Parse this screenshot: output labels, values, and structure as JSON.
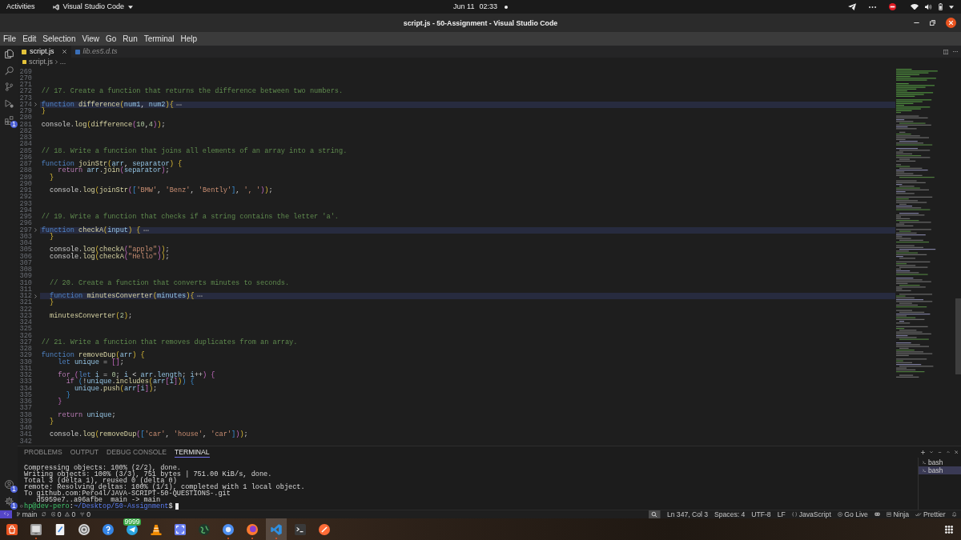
{
  "top_bar": {
    "activities": "Activities",
    "app_menu": "Visual Studio Code",
    "date": "Jun 11",
    "time": "02:33"
  },
  "window": {
    "title": "script.js - 50-Assignment - Visual Studio Code"
  },
  "menu": [
    "File",
    "Edit",
    "Selection",
    "View",
    "Go",
    "Run",
    "Terminal",
    "Help"
  ],
  "activity_bar": {
    "top": [
      {
        "kind": "explorer"
      },
      {
        "kind": "search"
      },
      {
        "kind": "scm"
      },
      {
        "kind": "run"
      },
      {
        "kind": "extensions",
        "badge": "1"
      }
    ],
    "bottom": [
      {
        "kind": "accounts",
        "badge": "1"
      },
      {
        "kind": "manage",
        "badge": "1"
      }
    ]
  },
  "tabs": [
    {
      "label": "script.js",
      "kind": "javascript",
      "selected": true,
      "preview": false
    },
    {
      "label": "lib.es5.d.ts",
      "kind": "typescript",
      "selected": false,
      "preview": true
    }
  ],
  "breadcrumb": [
    "script.js",
    "..."
  ],
  "editor": {
    "lines": [
      {
        "number": "269",
        "folded": false
      },
      {
        "number": "270",
        "folded": false
      },
      {
        "number": "271",
        "folded": false
      },
      {
        "number": "272",
        "folded": false,
        "tokens": [
          {
            "kind": "comment",
            "text": "// 17. Create a function that returns the difference between two numbers."
          }
        ]
      },
      {
        "number": "273",
        "folded": false
      },
      {
        "number": "274",
        "folded": true,
        "tokens": [
          {
            "kind": "keyword",
            "text": "function "
          },
          {
            "kind": "function",
            "text": "difference"
          },
          {
            "kind": "bracket1",
            "text": "("
          },
          {
            "kind": "variable",
            "text": "num1"
          },
          {
            "kind": "plain",
            "text": ", "
          },
          {
            "kind": "variable",
            "text": "num2"
          },
          {
            "kind": "bracket1",
            "text": "){"
          }
        ]
      },
      {
        "number": "279",
        "folded": false,
        "tokens": [
          {
            "kind": "bracket1",
            "text": "}"
          }
        ]
      },
      {
        "number": "280",
        "folded": false
      },
      {
        "number": "281",
        "folded": false,
        "tokens": [
          {
            "kind": "plain",
            "text": "console."
          },
          {
            "kind": "function",
            "text": "log"
          },
          {
            "kind": "bracket1",
            "text": "("
          },
          {
            "kind": "function",
            "text": "difference"
          },
          {
            "kind": "bracket2",
            "text": "("
          },
          {
            "kind": "number",
            "text": "10"
          },
          {
            "kind": "plain",
            "text": ","
          },
          {
            "kind": "number",
            "text": "4"
          },
          {
            "kind": "bracket2",
            "text": ")"
          },
          {
            "kind": "bracket1",
            "text": ")"
          },
          {
            "kind": "plain",
            "text": ";"
          }
        ]
      },
      {
        "number": "282",
        "folded": false
      },
      {
        "number": "283",
        "folded": false
      },
      {
        "number": "284",
        "folded": false
      },
      {
        "number": "285",
        "folded": false,
        "tokens": [
          {
            "kind": "comment",
            "text": "// 18. Write a function that joins all elements of an array into a string."
          }
        ]
      },
      {
        "number": "286",
        "folded": false
      },
      {
        "number": "287",
        "folded": false,
        "tokens": [
          {
            "kind": "keyword",
            "text": "function "
          },
          {
            "kind": "function",
            "text": "joinStr"
          },
          {
            "kind": "bracket1",
            "text": "("
          },
          {
            "kind": "variable",
            "text": "arr"
          },
          {
            "kind": "plain",
            "text": ", "
          },
          {
            "kind": "variable",
            "text": "separator"
          },
          {
            "kind": "bracket1",
            "text": ") {"
          }
        ]
      },
      {
        "number": "288",
        "folded": false,
        "tokens": [
          {
            "kind": "control",
            "text": "    return "
          },
          {
            "kind": "variable",
            "text": "arr"
          },
          {
            "kind": "plain",
            "text": "."
          },
          {
            "kind": "function",
            "text": "join"
          },
          {
            "kind": "bracket2",
            "text": "("
          },
          {
            "kind": "variable",
            "text": "separator"
          },
          {
            "kind": "bracket2",
            "text": ")"
          },
          {
            "kind": "plain",
            "text": ";"
          }
        ]
      },
      {
        "number": "289",
        "folded": false,
        "tokens": [
          {
            "kind": "bracket1",
            "text": "  }"
          }
        ]
      },
      {
        "number": "290",
        "folded": false
      },
      {
        "number": "291",
        "folded": false,
        "tokens": [
          {
            "kind": "plain",
            "text": "  console."
          },
          {
            "kind": "function",
            "text": "log"
          },
          {
            "kind": "bracket1",
            "text": "("
          },
          {
            "kind": "function",
            "text": "joinStr"
          },
          {
            "kind": "bracket2",
            "text": "("
          },
          {
            "kind": "bracket3",
            "text": "["
          },
          {
            "kind": "string",
            "text": "'BMW'"
          },
          {
            "kind": "plain",
            "text": ", "
          },
          {
            "kind": "string",
            "text": "'Benz'"
          },
          {
            "kind": "plain",
            "text": ", "
          },
          {
            "kind": "string",
            "text": "'Bently'"
          },
          {
            "kind": "bracket3",
            "text": "]"
          },
          {
            "kind": "plain",
            "text": ", "
          },
          {
            "kind": "string",
            "text": "', '"
          },
          {
            "kind": "bracket2",
            "text": ")"
          },
          {
            "kind": "bracket1",
            "text": ")"
          },
          {
            "kind": "plain",
            "text": ";"
          }
        ]
      },
      {
        "number": "292",
        "folded": false
      },
      {
        "number": "293",
        "folded": false
      },
      {
        "number": "294",
        "folded": false
      },
      {
        "number": "295",
        "folded": false,
        "tokens": [
          {
            "kind": "comment",
            "text": "// 19. Write a function that checks if a string contains the letter 'a'."
          }
        ]
      },
      {
        "number": "296",
        "folded": false
      },
      {
        "number": "297",
        "folded": true,
        "tokens": [
          {
            "kind": "keyword",
            "text": "function "
          },
          {
            "kind": "function",
            "text": "checkA"
          },
          {
            "kind": "bracket1",
            "text": "("
          },
          {
            "kind": "variable",
            "text": "input"
          },
          {
            "kind": "bracket1",
            "text": ") {"
          }
        ]
      },
      {
        "number": "303",
        "folded": false,
        "tokens": [
          {
            "kind": "bracket1",
            "text": "  }"
          }
        ]
      },
      {
        "number": "304",
        "folded": false
      },
      {
        "number": "305",
        "folded": false,
        "tokens": [
          {
            "kind": "plain",
            "text": "  console."
          },
          {
            "kind": "function",
            "text": "log"
          },
          {
            "kind": "bracket1",
            "text": "("
          },
          {
            "kind": "function",
            "text": "checkA"
          },
          {
            "kind": "bracket2",
            "text": "("
          },
          {
            "kind": "string",
            "text": "\"apple\""
          },
          {
            "kind": "bracket2",
            "text": ")"
          },
          {
            "kind": "bracket1",
            "text": ")"
          },
          {
            "kind": "plain",
            "text": ";"
          }
        ]
      },
      {
        "number": "306",
        "folded": false,
        "tokens": [
          {
            "kind": "plain",
            "text": "  console."
          },
          {
            "kind": "function",
            "text": "log"
          },
          {
            "kind": "bracket1",
            "text": "("
          },
          {
            "kind": "function",
            "text": "checkA"
          },
          {
            "kind": "bracket2",
            "text": "("
          },
          {
            "kind": "string",
            "text": "\"Hello\""
          },
          {
            "kind": "bracket2",
            "text": ")"
          },
          {
            "kind": "bracket1",
            "text": ")"
          },
          {
            "kind": "plain",
            "text": ";"
          }
        ]
      },
      {
        "number": "307",
        "folded": false
      },
      {
        "number": "308",
        "folded": false
      },
      {
        "number": "309",
        "folded": false
      },
      {
        "number": "310",
        "folded": false,
        "tokens": [
          {
            "kind": "comment",
            "text": "  // 20. Create a function that converts minutes to seconds."
          }
        ]
      },
      {
        "number": "311",
        "folded": false
      },
      {
        "number": "312",
        "folded": true,
        "tokens": [
          {
            "kind": "keyword",
            "text": "  function "
          },
          {
            "kind": "function",
            "text": "minutesConverter"
          },
          {
            "kind": "bracket1",
            "text": "("
          },
          {
            "kind": "variable",
            "text": "minutes"
          },
          {
            "kind": "bracket1",
            "text": "){"
          }
        ]
      },
      {
        "number": "321",
        "folded": false,
        "tokens": [
          {
            "kind": "bracket1",
            "text": "  }"
          }
        ]
      },
      {
        "number": "322",
        "folded": false
      },
      {
        "number": "323",
        "folded": false,
        "tokens": [
          {
            "kind": "function",
            "text": "  minutesConverter"
          },
          {
            "kind": "bracket1",
            "text": "("
          },
          {
            "kind": "number",
            "text": "2"
          },
          {
            "kind": "bracket1",
            "text": ")"
          },
          {
            "kind": "plain",
            "text": ";"
          }
        ]
      },
      {
        "number": "324",
        "folded": false
      },
      {
        "number": "325",
        "folded": false
      },
      {
        "number": "326",
        "folded": false
      },
      {
        "number": "327",
        "folded": false,
        "tokens": [
          {
            "kind": "comment",
            "text": "// 21. Write a function that removes duplicates from an array."
          }
        ]
      },
      {
        "number": "328",
        "folded": false
      },
      {
        "number": "329",
        "folded": false,
        "tokens": [
          {
            "kind": "keyword",
            "text": "function "
          },
          {
            "kind": "function",
            "text": "removeDup"
          },
          {
            "kind": "bracket1",
            "text": "("
          },
          {
            "kind": "variable",
            "text": "arr"
          },
          {
            "kind": "bracket1",
            "text": ") {"
          }
        ]
      },
      {
        "number": "330",
        "folded": false,
        "tokens": [
          {
            "kind": "keyword",
            "text": "    let "
          },
          {
            "kind": "variable",
            "text": "unique"
          },
          {
            "kind": "plain",
            "text": " = "
          },
          {
            "kind": "bracket2",
            "text": "[]"
          },
          {
            "kind": "plain",
            "text": ";"
          }
        ]
      },
      {
        "number": "331",
        "folded": false
      },
      {
        "number": "332",
        "folded": false,
        "tokens": [
          {
            "kind": "control",
            "text": "    for "
          },
          {
            "kind": "bracket2",
            "text": "("
          },
          {
            "kind": "keyword",
            "text": "let "
          },
          {
            "kind": "variable",
            "text": "i"
          },
          {
            "kind": "plain",
            "text": " = "
          },
          {
            "kind": "number",
            "text": "0"
          },
          {
            "kind": "plain",
            "text": "; "
          },
          {
            "kind": "variable",
            "text": "i"
          },
          {
            "kind": "plain",
            "text": " < "
          },
          {
            "kind": "variable",
            "text": "arr"
          },
          {
            "kind": "plain",
            "text": "."
          },
          {
            "kind": "variable",
            "text": "length"
          },
          {
            "kind": "plain",
            "text": "; "
          },
          {
            "kind": "variable",
            "text": "i"
          },
          {
            "kind": "plain",
            "text": "++"
          },
          {
            "kind": "bracket2",
            "text": ") {"
          }
        ]
      },
      {
        "number": "333",
        "folded": false,
        "tokens": [
          {
            "kind": "control",
            "text": "      if "
          },
          {
            "kind": "bracket3",
            "text": "("
          },
          {
            "kind": "plain",
            "text": "!"
          },
          {
            "kind": "variable",
            "text": "unique"
          },
          {
            "kind": "plain",
            "text": "."
          },
          {
            "kind": "function",
            "text": "includes"
          },
          {
            "kind": "bracket1",
            "text": "("
          },
          {
            "kind": "variable",
            "text": "arr"
          },
          {
            "kind": "bracket2",
            "text": "["
          },
          {
            "kind": "variable",
            "text": "i"
          },
          {
            "kind": "bracket2",
            "text": "]"
          },
          {
            "kind": "bracket1",
            "text": ")"
          },
          {
            "kind": "bracket3",
            "text": ") {"
          }
        ]
      },
      {
        "number": "334",
        "folded": false,
        "tokens": [
          {
            "kind": "variable",
            "text": "        unique"
          },
          {
            "kind": "plain",
            "text": "."
          },
          {
            "kind": "function",
            "text": "push"
          },
          {
            "kind": "bracket1",
            "text": "("
          },
          {
            "kind": "variable",
            "text": "arr"
          },
          {
            "kind": "bracket2",
            "text": "["
          },
          {
            "kind": "variable",
            "text": "i"
          },
          {
            "kind": "bracket2",
            "text": "]"
          },
          {
            "kind": "bracket1",
            "text": ")"
          },
          {
            "kind": "plain",
            "text": ";"
          }
        ]
      },
      {
        "number": "335",
        "folded": false,
        "tokens": [
          {
            "kind": "bracket3",
            "text": "      }"
          }
        ]
      },
      {
        "number": "336",
        "folded": false,
        "tokens": [
          {
            "kind": "bracket2",
            "text": "    }"
          }
        ]
      },
      {
        "number": "337",
        "folded": false
      },
      {
        "number": "338",
        "folded": false,
        "tokens": [
          {
            "kind": "control",
            "text": "    return "
          },
          {
            "kind": "variable",
            "text": "unique"
          },
          {
            "kind": "plain",
            "text": ";"
          }
        ]
      },
      {
        "number": "339",
        "folded": false,
        "tokens": [
          {
            "kind": "bracket1",
            "text": "  }"
          }
        ]
      },
      {
        "number": "340",
        "folded": false
      },
      {
        "number": "341",
        "folded": false,
        "tokens": [
          {
            "kind": "plain",
            "text": "  console."
          },
          {
            "kind": "function",
            "text": "log"
          },
          {
            "kind": "bracket1",
            "text": "("
          },
          {
            "kind": "function",
            "text": "removeDup"
          },
          {
            "kind": "bracket2",
            "text": "("
          },
          {
            "kind": "bracket3",
            "text": "["
          },
          {
            "kind": "string",
            "text": "'car'"
          },
          {
            "kind": "plain",
            "text": ", "
          },
          {
            "kind": "string",
            "text": "'house'"
          },
          {
            "kind": "plain",
            "text": ", "
          },
          {
            "kind": "string",
            "text": "'car'"
          },
          {
            "kind": "bracket3",
            "text": "]"
          },
          {
            "kind": "bracket2",
            "text": ")"
          },
          {
            "kind": "bracket1",
            "text": ")"
          },
          {
            "kind": "plain",
            "text": ";"
          }
        ]
      },
      {
        "number": "342",
        "folded": false
      }
    ]
  },
  "panel": {
    "tabs": [
      {
        "label": "PROBLEMS",
        "selected": false
      },
      {
        "label": "OUTPUT",
        "selected": false
      },
      {
        "label": "DEBUG CONSOLE",
        "selected": false
      },
      {
        "label": "TERMINAL",
        "selected": true
      }
    ],
    "terminal": {
      "output": [
        "Compressing objects: 100% (2/2), done.",
        "Writing objects: 100% (3/3), 751 bytes | 751.00 KiB/s, done.",
        "Total 3 (delta 1), reused 0 (delta 0)",
        "remote: Resolving deltas: 100% (1/1), completed with 1 local object.",
        "To github.com:Pero4l/JAVA-SCRIPT-50-QUESTIONS-.git",
        "   d5959e7..a96afbe  main -> main"
      ],
      "prompt": [
        {
          "kind": "user",
          "text": "hp@dev-pero"
        },
        {
          "kind": "plain",
          "text": ":"
        },
        {
          "kind": "path",
          "text": "~/Desktop/50-Assignment"
        },
        {
          "kind": "plain",
          "text": "$"
        }
      ]
    },
    "sessions": [
      {
        "label": "bash",
        "selected": false
      },
      {
        "label": "bash",
        "selected": true
      }
    ]
  },
  "status_bar": {
    "branch": "main",
    "errors": "0",
    "warnings": "0",
    "ports": "0",
    "items": [
      {
        "kind": "search"
      },
      {
        "kind": "plain",
        "text": "Ln 347, Col 3"
      },
      {
        "kind": "plain",
        "text": "Spaces: 4"
      },
      {
        "kind": "plain",
        "text": "UTF-8"
      },
      {
        "kind": "plain",
        "text": "LF"
      },
      {
        "kind": "language",
        "text": "JavaScript"
      },
      {
        "kind": "golive",
        "text": "Go Live"
      },
      {
        "kind": "goggles"
      },
      {
        "kind": "ninja",
        "text": "Ninja"
      },
      {
        "kind": "prettier",
        "text": "Prettier"
      },
      {
        "kind": "bell"
      }
    ]
  },
  "dock": {
    "apps": [
      {
        "kind": "bag",
        "running": false,
        "selected": false
      },
      {
        "kind": "drawer",
        "running": true,
        "selected": false
      },
      {
        "kind": "notepad",
        "running": false,
        "selected": false
      },
      {
        "kind": "rings",
        "running": false,
        "selected": false
      },
      {
        "kind": "help",
        "running": false,
        "selected": false
      },
      {
        "kind": "plane",
        "running": false,
        "selected": false,
        "badge": "9999"
      },
      {
        "kind": "cone",
        "running": false,
        "selected": false
      },
      {
        "kind": "frame",
        "running": false,
        "selected": false
      },
      {
        "kind": "globe",
        "running": false,
        "selected": false
      },
      {
        "kind": "ring",
        "running": true,
        "selected": false
      },
      {
        "kind": "flame",
        "running": true,
        "selected": false
      },
      {
        "kind": "ribbon",
        "running": true,
        "selected": true
      },
      {
        "kind": "terminal",
        "running": false,
        "selected": false
      },
      {
        "kind": "slash",
        "running": false,
        "selected": false
      }
    ]
  }
}
